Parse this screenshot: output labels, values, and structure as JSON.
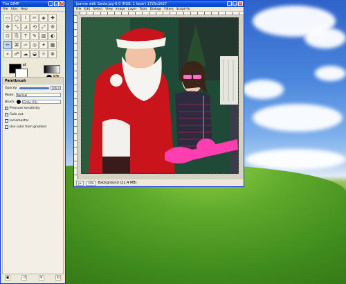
{
  "toolbox": {
    "title": "The GIMP",
    "menu": [
      "File",
      "Xtns",
      "Help"
    ],
    "tools": [
      "▭",
      "◯",
      "⌇",
      "✂",
      "◈",
      "✚",
      "✥",
      "⤡",
      "⊿",
      "⟲",
      "⤢",
      "⟰",
      "⊡",
      "⎘",
      "T",
      "✎",
      "▥",
      "◐",
      "✏",
      "⌘",
      "✑",
      "◎",
      "✦",
      "▦",
      "⌖",
      "☍",
      "☁",
      "◒",
      "☼",
      "⊗"
    ],
    "options": {
      "heading": "Paintbrush",
      "opacity_label": "Opacity:",
      "opacity_value": "100.0",
      "mode_label": "Mode:",
      "mode_value": "Normal",
      "brush_label": "Brush:",
      "brush_value": "Circle (11)",
      "checkboxes": [
        {
          "label": "Pressure sensitivity",
          "checked": true
        },
        {
          "label": "Fade out",
          "checked": false
        },
        {
          "label": "Incremental",
          "checked": false
        },
        {
          "label": "Use color from gradient",
          "checked": false
        }
      ]
    }
  },
  "image_window": {
    "title": "Joanne with Santa.jpg-6.0 (RGB, 1 layer) 1725x1627",
    "menu": [
      "File",
      "Edit",
      "Select",
      "View",
      "Image",
      "Layer",
      "Tools",
      "Dialogs",
      "Filters",
      "Script-Fu"
    ],
    "status": {
      "unit": "px",
      "zoom": "10%",
      "info": "Background (21.4 MB)"
    }
  }
}
